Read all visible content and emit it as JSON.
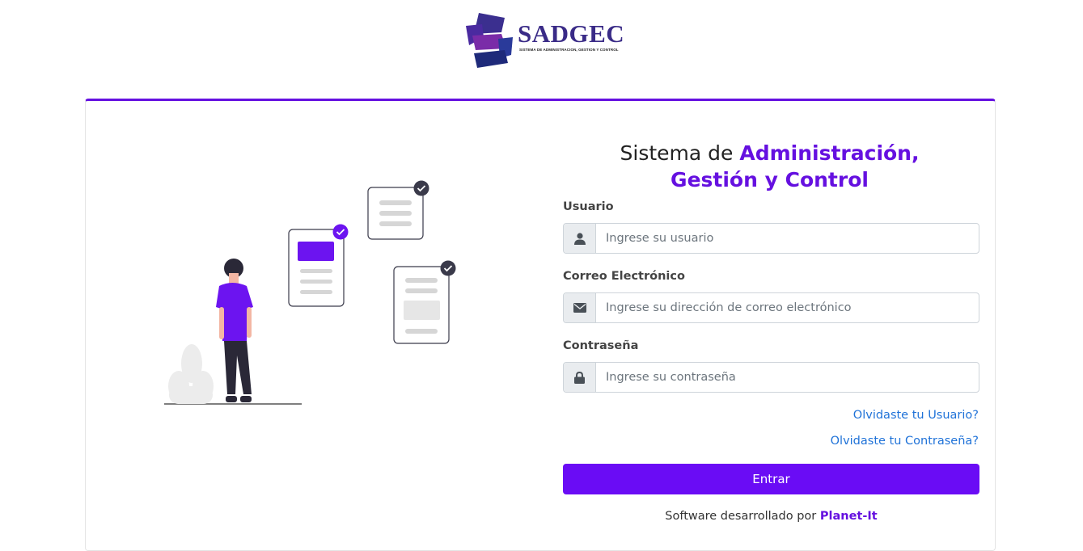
{
  "logo": {
    "name": "SADGEC",
    "tagline": "SISTEMA DE ADMINISTRACION, GESTION Y CONTROL"
  },
  "header": {
    "title_prefix": "Sistema de ",
    "title_accent_line1": "Administración,",
    "title_accent_line2": "Gestión y Control"
  },
  "form": {
    "user_label": "Usuario",
    "user_placeholder": "Ingrese su usuario",
    "email_label": "Correo Electrónico",
    "email_placeholder": "Ingrese su dirección de correo electrónico",
    "password_label": "Contraseña",
    "password_placeholder": "Ingrese su contraseña",
    "forgot_user": "Olvidaste tu Usuario?",
    "forgot_password": "Olvidaste tu Contraseña?",
    "submit_label": "Entrar"
  },
  "footer": {
    "text": "Software desarrollado por ",
    "brand": "Planet-It"
  },
  "colors": {
    "accent": "#6510e0",
    "button": "#6a0cf5",
    "link": "#1f72d8",
    "logo_text": "#3a2b87"
  },
  "icons": {
    "user_field": "user-icon",
    "email_field": "envelope-icon",
    "password_field": "lock-icon"
  }
}
